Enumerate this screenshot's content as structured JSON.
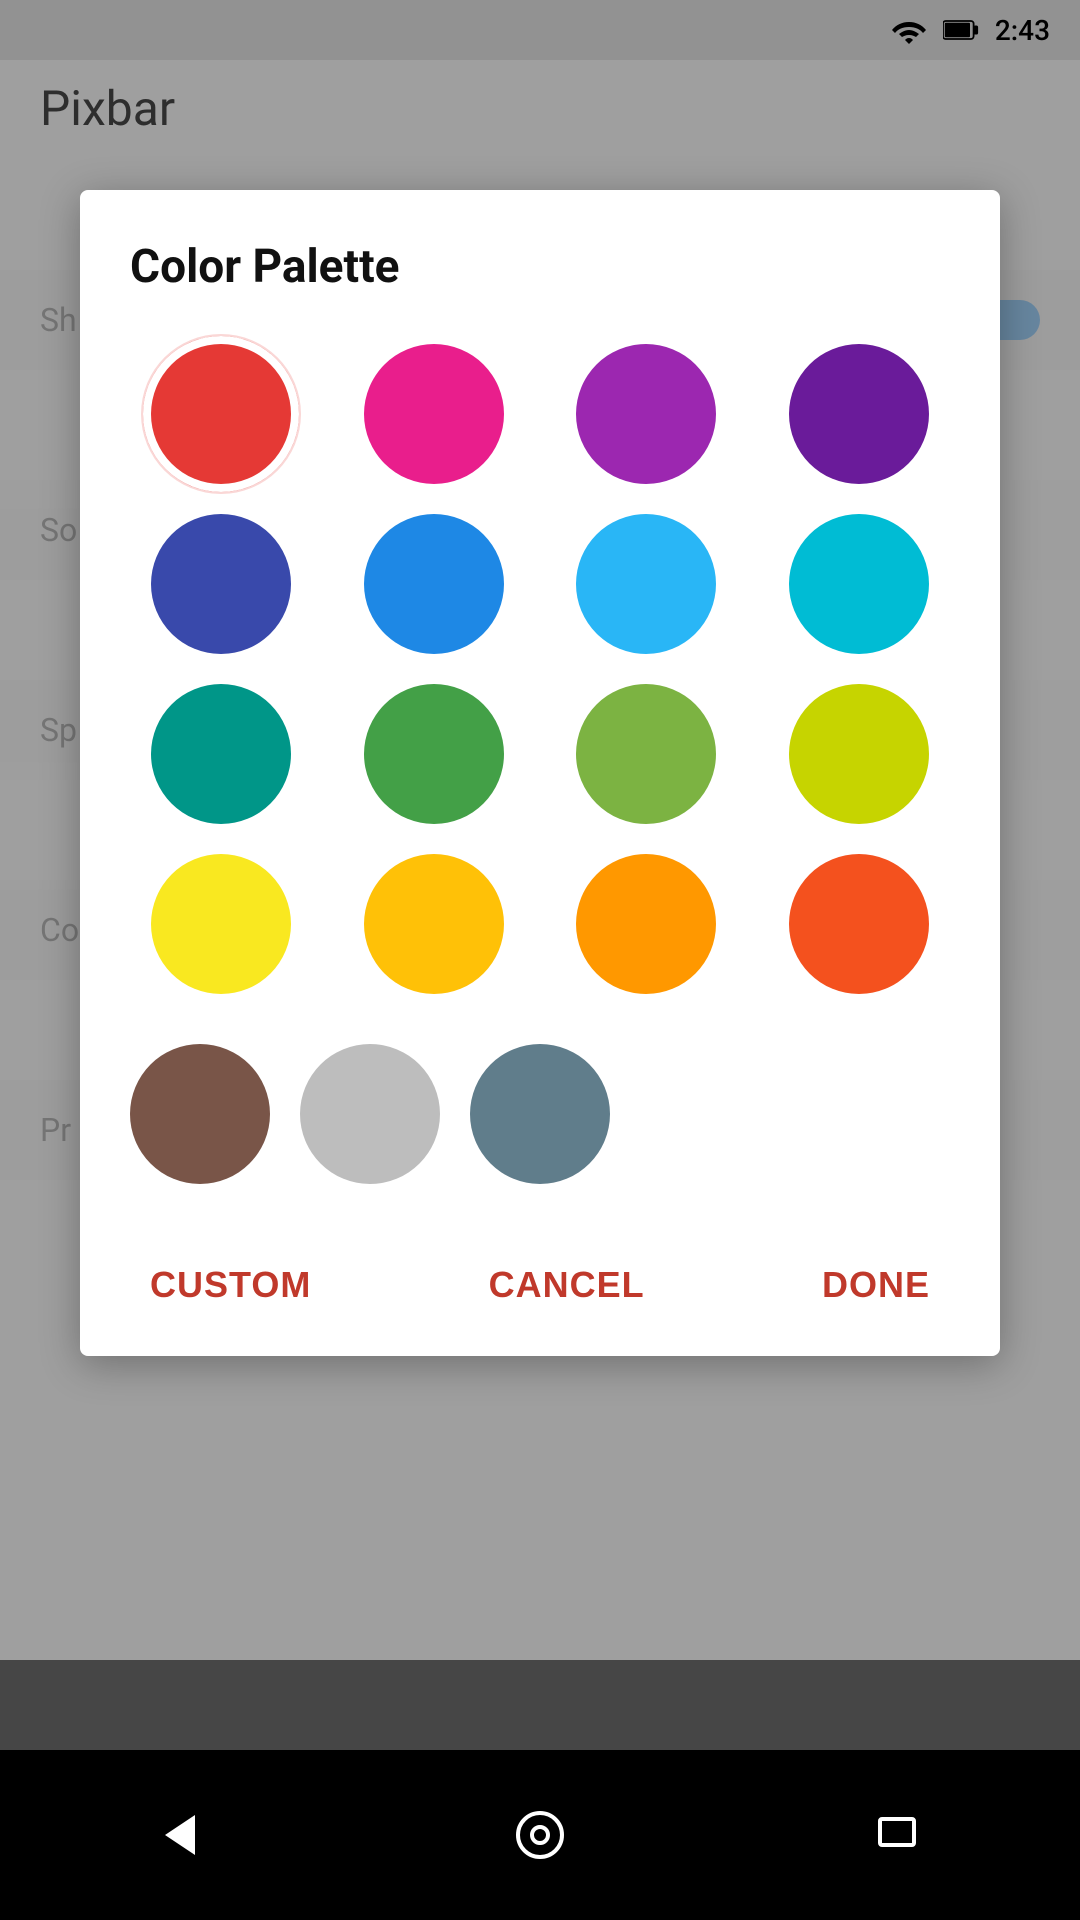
{
  "statusBar": {
    "time": "2:43"
  },
  "app": {
    "title": "Pixbar"
  },
  "dialog": {
    "title": "Color Palette",
    "colors": [
      {
        "id": "red",
        "hex": "#e53935",
        "selected": true
      },
      {
        "id": "pink",
        "hex": "#e91e8c"
      },
      {
        "id": "magenta",
        "hex": "#9c27b0"
      },
      {
        "id": "deep-purple",
        "hex": "#6a1b9a"
      },
      {
        "id": "indigo",
        "hex": "#3949ab"
      },
      {
        "id": "blue",
        "hex": "#1e88e5"
      },
      {
        "id": "light-blue",
        "hex": "#29b6f6"
      },
      {
        "id": "cyan",
        "hex": "#00bcd4"
      },
      {
        "id": "teal",
        "hex": "#009688"
      },
      {
        "id": "green",
        "hex": "#43a047"
      },
      {
        "id": "light-green",
        "hex": "#7cb342"
      },
      {
        "id": "lime",
        "hex": "#c6d400"
      },
      {
        "id": "yellow",
        "hex": "#f9e820"
      },
      {
        "id": "amber",
        "hex": "#ffc107"
      },
      {
        "id": "orange",
        "hex": "#ff9800"
      },
      {
        "id": "deep-orange",
        "hex": "#f4511e"
      },
      {
        "id": "brown",
        "hex": "#795548"
      },
      {
        "id": "grey",
        "hex": "#bdbdbd"
      },
      {
        "id": "blue-grey",
        "hex": "#607d8b"
      }
    ],
    "actions": {
      "custom": "CUSTOM",
      "cancel": "CANCEL",
      "done": "DONE"
    }
  },
  "bottomNav": {
    "back": "◀",
    "home": "○",
    "recents": "▭"
  }
}
